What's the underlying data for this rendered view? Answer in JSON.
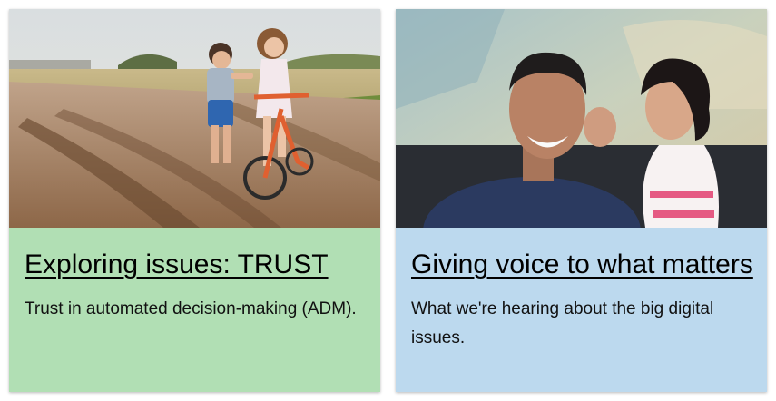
{
  "colors": {
    "card_1_background": "#b1dfb4",
    "card_2_background": "#bcd9ee",
    "text": "#000000"
  },
  "cards": [
    {
      "image_alt": "Two children with a bicycle on a dirt road",
      "title": "Exploring issues: TRUST",
      "description": "Trust in automated decision-making (ADM)."
    },
    {
      "image_alt": "Girl whispering in a laughing man's ear",
      "title": "Giving voice to what matters",
      "description": "What we're hearing about the big digital issues."
    }
  ]
}
